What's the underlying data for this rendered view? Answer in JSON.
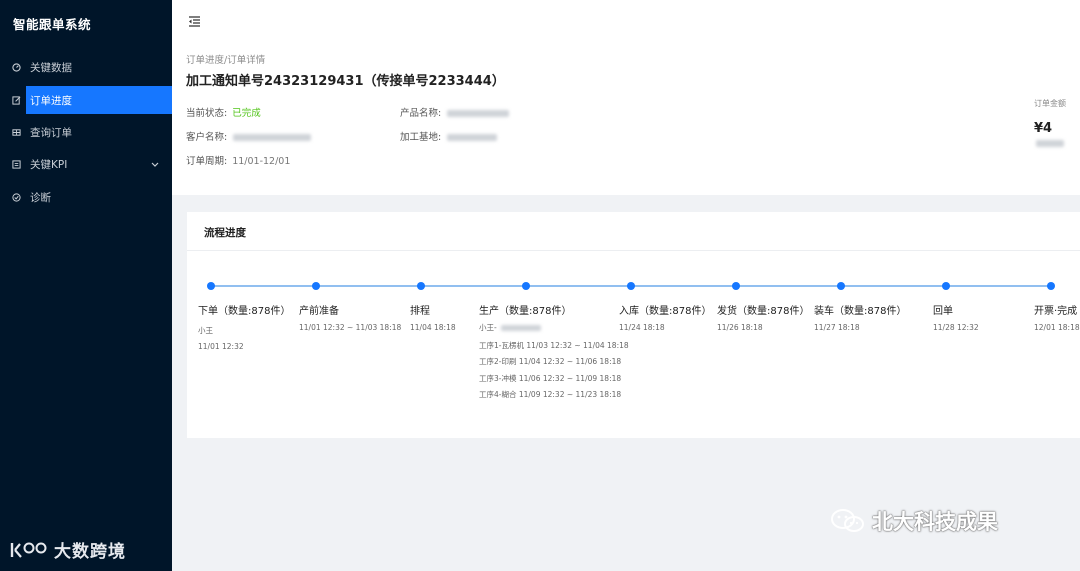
{
  "app": {
    "title": "智能跟单系统"
  },
  "sidebar": {
    "items": [
      {
        "label": "关键数据",
        "icon": "dashboard-icon"
      },
      {
        "label": "订单进度",
        "icon": "edit-icon",
        "active": true
      },
      {
        "label": "查询订单",
        "icon": "table-icon"
      },
      {
        "label": "关键KPI",
        "icon": "kpi-icon",
        "expandable": true
      },
      {
        "label": "诊断",
        "icon": "check-circle-icon"
      }
    ],
    "footer_logo": "大数跨境"
  },
  "header": {
    "toggle_icon": "menu-fold-icon"
  },
  "detail": {
    "breadcrumb": "订单进度/订单详情",
    "title": "加工通知单号24323129431（传接单号2233444）",
    "status_label": "当前状态:",
    "status_value": "已完成",
    "customer_label": "客户名称:",
    "period_label": "订单周期:",
    "period_value": "11/01-12/01",
    "product_label": "产品名称:",
    "base_label": "加工基地:",
    "amount_label": "订单金额",
    "amount_value": "¥4"
  },
  "progress": {
    "title": "流程进度",
    "steps": [
      {
        "label": "下单（数量:878件）",
        "lines": [
          "小王",
          "11/01 12:32"
        ]
      },
      {
        "label": "产前准备",
        "lines": [
          "11/01 12:32 ~ 11/03 18:18"
        ]
      },
      {
        "label": "排程",
        "lines": [
          "11/04 18:18"
        ]
      },
      {
        "label": "生产（数量:878件）",
        "lines": [
          "小王-",
          "工序1-瓦楞机 11/03 12:32 ~ 11/04 18:18",
          "工序2-印刷 11/04 12:32 ~ 11/06 18:18",
          "工序3-冲模 11/06 12:32 ~ 11/09 18:18",
          "工序4-糊合 11/09 12:32 ~ 11/23 18:18"
        ]
      },
      {
        "label": "入库（数量:878件）",
        "lines": [
          "11/24 18:18"
        ]
      },
      {
        "label": "发货（数量:878件）",
        "lines": [
          "11/26 18:18"
        ]
      },
      {
        "label": "装车（数量:878件）",
        "lines": [
          "11/27 18:18"
        ]
      },
      {
        "label": "回单",
        "lines": [
          "11/28 12:32"
        ]
      },
      {
        "label": "开票·完成",
        "lines": [
          "12/01 18:18"
        ]
      }
    ]
  },
  "watermark": "北大科技成果",
  "colors": {
    "sidebar": "#001529",
    "accent": "#1677ff",
    "success": "#52c41a"
  }
}
